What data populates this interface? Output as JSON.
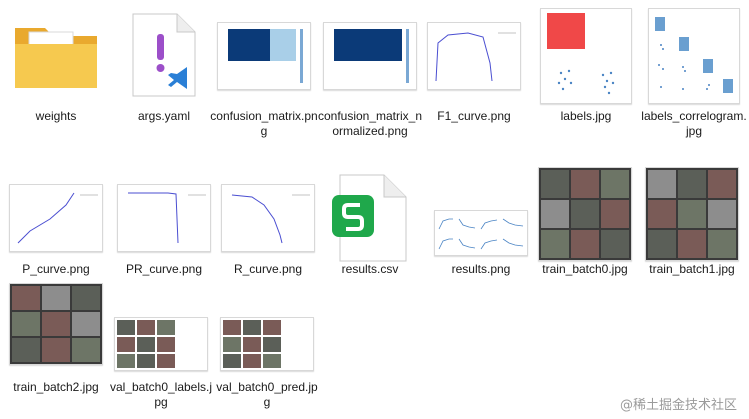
{
  "files": [
    {
      "name": "weights",
      "type": "folder",
      "icon": "folder-icon"
    },
    {
      "name": "args.yaml",
      "type": "yaml",
      "icon": "yaml-file-icon"
    },
    {
      "name": "confusion_matrix.png",
      "type": "image"
    },
    {
      "name": "confusion_matrix_normalized.png",
      "type": "image"
    },
    {
      "name": "F1_curve.png",
      "type": "image"
    },
    {
      "name": "labels.jpg",
      "type": "image"
    },
    {
      "name": "labels_correlogram.jpg",
      "type": "image"
    },
    {
      "name": "P_curve.png",
      "type": "image"
    },
    {
      "name": "PR_curve.png",
      "type": "image"
    },
    {
      "name": "R_curve.png",
      "type": "image"
    },
    {
      "name": "results.csv",
      "type": "csv",
      "icon": "spreadsheet-icon"
    },
    {
      "name": "results.png",
      "type": "image"
    },
    {
      "name": "train_batch0.jpg",
      "type": "image"
    },
    {
      "name": "train_batch1.jpg",
      "type": "image"
    },
    {
      "name": "train_batch2.jpg",
      "type": "image"
    },
    {
      "name": "val_batch0_labels.jpg",
      "type": "image"
    },
    {
      "name": "val_batch0_pred.jpg",
      "type": "image"
    }
  ],
  "watermark": "@稀土掘金技术社区",
  "colors": {
    "folder": "#f4c34a",
    "matrix": "#0b3a78",
    "curve": "#4a4ed1",
    "csv": "#1fa84b",
    "accent": "#e53935"
  }
}
